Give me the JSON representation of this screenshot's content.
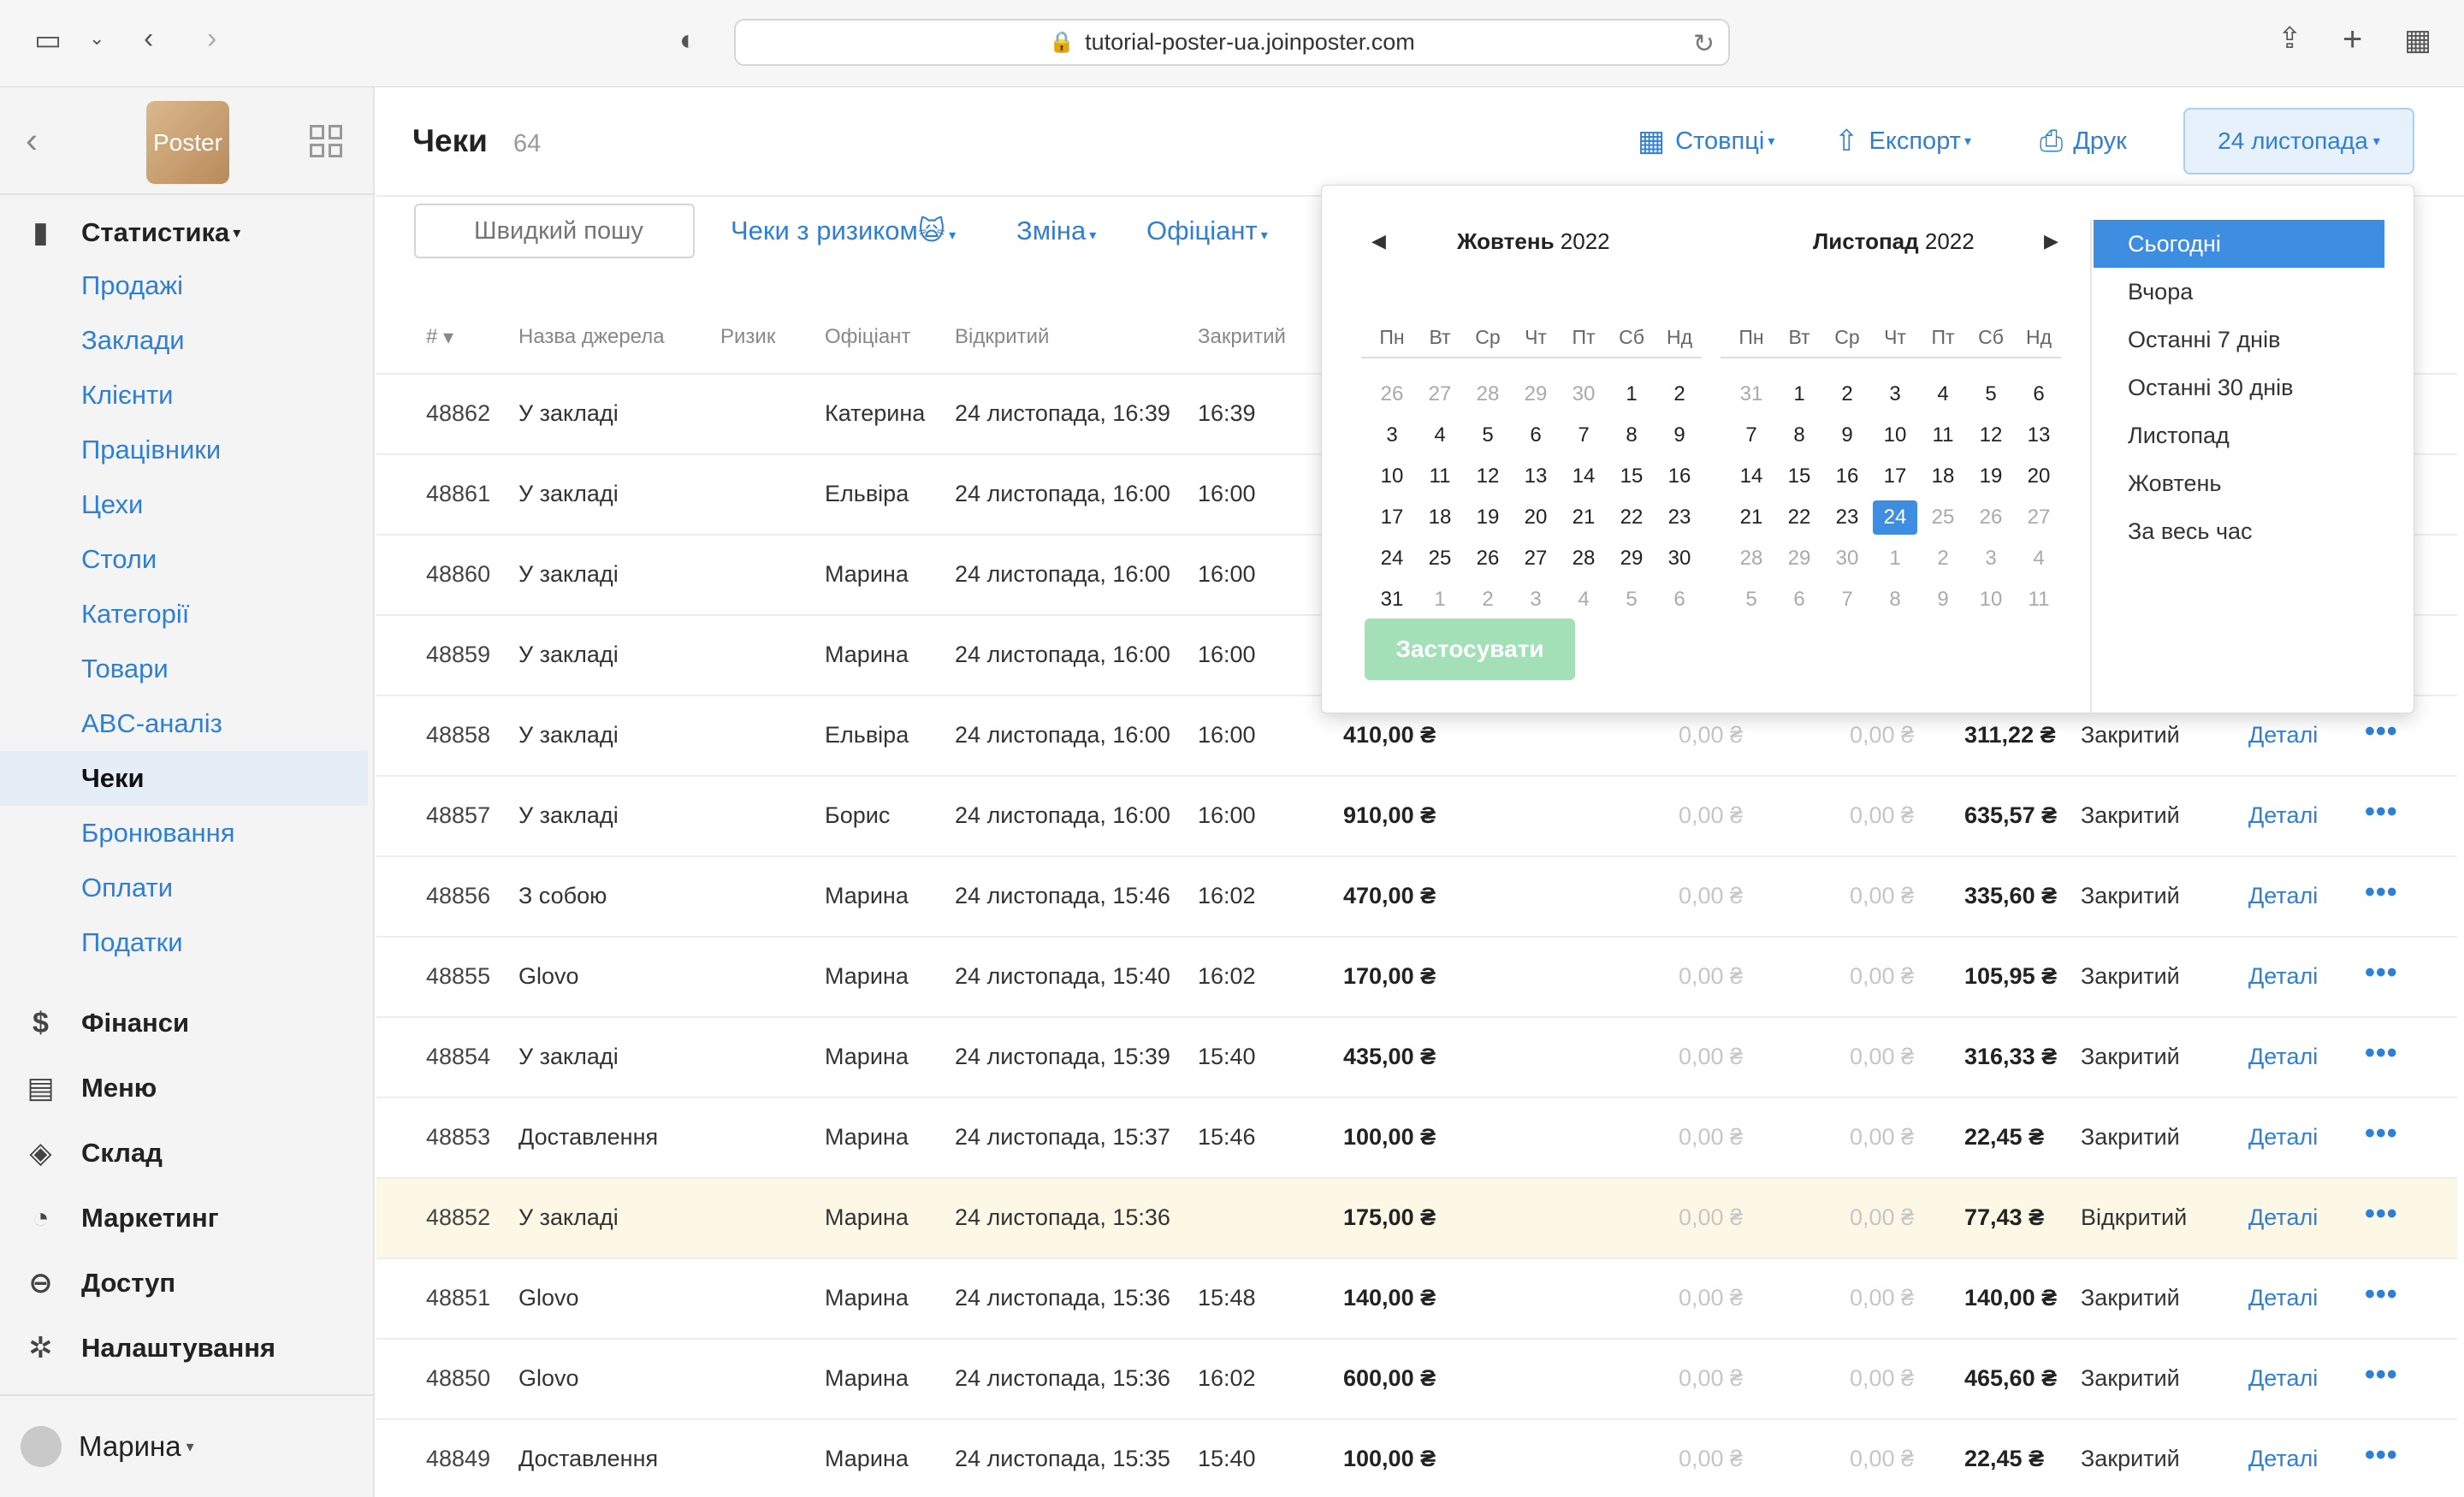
{
  "browser": {
    "url": "tutorial-poster-ua.joinposter.com"
  },
  "sidebar": {
    "logo_text": "Poster",
    "sections": [
      {
        "label": "Статистика",
        "icon": "bar-chart-icon",
        "dropdown": true
      },
      {
        "label": "Фінанси",
        "icon": "dollar-icon"
      },
      {
        "label": "Меню",
        "icon": "document-icon"
      },
      {
        "label": "Склад",
        "icon": "layers-icon"
      },
      {
        "label": "Маркетинг",
        "icon": "pie-icon"
      },
      {
        "label": "Доступ",
        "icon": "lock-icon"
      },
      {
        "label": "Налаштування",
        "icon": "gear-icon"
      }
    ],
    "stat_items": [
      "Продажі",
      "Заклади",
      "Клієнти",
      "Працівники",
      "Цехи",
      "Столи",
      "Категорії",
      "Товари",
      "ABC-аналіз",
      "Чеки",
      "Бронювання",
      "Оплати",
      "Податки"
    ],
    "active_item": "Чеки",
    "user": "Марина"
  },
  "header": {
    "title": "Чеки",
    "count": "64",
    "columns_btn": "Стовпці",
    "export_btn": "Експорт",
    "print_btn": "Друк",
    "date_btn": "24 листопада"
  },
  "filters": {
    "search_placeholder": "Швидкий пошу",
    "risk": "Чеки з ризиком",
    "shift": "Зміна",
    "waiter": "Офіціант"
  },
  "table": {
    "headers": [
      "#",
      "Назва джерела",
      "Ризик",
      "Офіціант",
      "Відкритий",
      "Закритий"
    ],
    "rows": [
      {
        "id": "48862",
        "source": "У закладі",
        "waiter": "Катерина",
        "opened": "24 листопада, 16:39",
        "closed": "16:39"
      },
      {
        "id": "48861",
        "source": "У закладі",
        "waiter": "Ельвіра",
        "opened": "24 листопада, 16:00",
        "closed": "16:00"
      },
      {
        "id": "48860",
        "source": "У закладі",
        "waiter": "Марина",
        "opened": "24 листопада, 16:00",
        "closed": "16:00"
      },
      {
        "id": "48859",
        "source": "У закладі",
        "waiter": "Марина",
        "opened": "24 листопада, 16:00",
        "closed": "16:00"
      },
      {
        "id": "48858",
        "source": "У закладі",
        "waiter": "Ельвіра",
        "opened": "24 листопада, 16:00",
        "closed": "16:00",
        "sum": "410,00 ₴",
        "a": "0,00 ₴",
        "b": "0,00 ₴",
        "profit": "311,22 ₴",
        "status": "Закритий",
        "details": "Деталі"
      },
      {
        "id": "48857",
        "source": "У закладі",
        "waiter": "Борис",
        "opened": "24 листопада, 16:00",
        "closed": "16:00",
        "sum": "910,00 ₴",
        "a": "0,00 ₴",
        "b": "0,00 ₴",
        "profit": "635,57 ₴",
        "status": "Закритий",
        "details": "Деталі"
      },
      {
        "id": "48856",
        "source": "З собою",
        "waiter": "Марина",
        "opened": "24 листопада, 15:46",
        "closed": "16:02",
        "sum": "470,00 ₴",
        "a": "0,00 ₴",
        "b": "0,00 ₴",
        "profit": "335,60 ₴",
        "status": "Закритий",
        "details": "Деталі"
      },
      {
        "id": "48855",
        "source": "Glovo",
        "waiter": "Марина",
        "opened": "24 листопада, 15:40",
        "closed": "16:02",
        "sum": "170,00 ₴",
        "a": "0,00 ₴",
        "b": "0,00 ₴",
        "profit": "105,95 ₴",
        "status": "Закритий",
        "details": "Деталі"
      },
      {
        "id": "48854",
        "source": "У закладі",
        "waiter": "Марина",
        "opened": "24 листопада, 15:39",
        "closed": "15:40",
        "sum": "435,00 ₴",
        "a": "0,00 ₴",
        "b": "0,00 ₴",
        "profit": "316,33 ₴",
        "status": "Закритий",
        "details": "Деталі"
      },
      {
        "id": "48853",
        "source": "Доставлення",
        "waiter": "Марина",
        "opened": "24 листопада, 15:37",
        "closed": "15:46",
        "sum": "100,00 ₴",
        "a": "0,00 ₴",
        "b": "0,00 ₴",
        "profit": "22,45 ₴",
        "status": "Закритий",
        "details": "Деталі"
      },
      {
        "id": "48852",
        "source": "У закладі",
        "waiter": "Марина",
        "opened": "24 листопада, 15:36",
        "closed": "",
        "sum": "175,00 ₴",
        "a": "0,00 ₴",
        "b": "0,00 ₴",
        "profit": "77,43 ₴",
        "status": "Відкритий",
        "details": "Деталі",
        "open": true
      },
      {
        "id": "48851",
        "source": "Glovo",
        "waiter": "Марина",
        "opened": "24 листопада, 15:36",
        "closed": "15:48",
        "sum": "140,00 ₴",
        "a": "0,00 ₴",
        "b": "0,00 ₴",
        "profit": "140,00 ₴",
        "status": "Закритий",
        "details": "Деталі"
      },
      {
        "id": "48850",
        "source": "Glovo",
        "waiter": "Марина",
        "opened": "24 листопада, 15:36",
        "closed": "16:02",
        "sum": "600,00 ₴",
        "a": "0,00 ₴",
        "b": "0,00 ₴",
        "profit": "465,60 ₴",
        "status": "Закритий",
        "details": "Деталі"
      },
      {
        "id": "48849",
        "source": "Доставлення",
        "waiter": "Марина",
        "opened": "24 листопада, 15:35",
        "closed": "15:40",
        "sum": "100,00 ₴",
        "a": "0,00 ₴",
        "b": "0,00 ₴",
        "profit": "22,45 ₴",
        "status": "Закритий",
        "details": "Деталі"
      }
    ]
  },
  "calendar": {
    "dow": [
      "Пн",
      "Вт",
      "Ср",
      "Чт",
      "Пт",
      "Сб",
      "Нд"
    ],
    "left": {
      "month": "Жовтень",
      "year": "2022",
      "weeks": [
        [
          "26",
          "27",
          "28",
          "29",
          "30",
          "1",
          "2"
        ],
        [
          "3",
          "4",
          "5",
          "6",
          "7",
          "8",
          "9"
        ],
        [
          "10",
          "11",
          "12",
          "13",
          "14",
          "15",
          "16"
        ],
        [
          "17",
          "18",
          "19",
          "20",
          "21",
          "22",
          "23"
        ],
        [
          "24",
          "25",
          "26",
          "27",
          "28",
          "29",
          "30"
        ],
        [
          "31",
          "1",
          "2",
          "3",
          "4",
          "5",
          "6"
        ]
      ],
      "muted": [
        [
          0,
          0
        ],
        [
          0,
          1
        ],
        [
          0,
          2
        ],
        [
          0,
          3
        ],
        [
          0,
          4
        ],
        [
          5,
          1
        ],
        [
          5,
          2
        ],
        [
          5,
          3
        ],
        [
          5,
          4
        ],
        [
          5,
          5
        ],
        [
          5,
          6
        ]
      ]
    },
    "right": {
      "month": "Листопад",
      "year": "2022",
      "weeks": [
        [
          "31",
          "1",
          "2",
          "3",
          "4",
          "5",
          "6"
        ],
        [
          "7",
          "8",
          "9",
          "10",
          "11",
          "12",
          "13"
        ],
        [
          "14",
          "15",
          "16",
          "17",
          "18",
          "19",
          "20"
        ],
        [
          "21",
          "22",
          "23",
          "24",
          "25",
          "26",
          "27"
        ],
        [
          "28",
          "29",
          "30",
          "1",
          "2",
          "3",
          "4"
        ],
        [
          "5",
          "6",
          "7",
          "8",
          "9",
          "10",
          "11"
        ]
      ],
      "muted": [
        [
          0,
          0
        ],
        [
          3,
          4
        ],
        [
          3,
          5
        ],
        [
          3,
          6
        ],
        [
          4,
          0
        ],
        [
          4,
          1
        ],
        [
          4,
          2
        ],
        [
          4,
          3
        ],
        [
          4,
          4
        ],
        [
          4,
          5
        ],
        [
          4,
          6
        ],
        [
          5,
          0
        ],
        [
          5,
          1
        ],
        [
          5,
          2
        ],
        [
          5,
          3
        ],
        [
          5,
          4
        ],
        [
          5,
          5
        ],
        [
          5,
          6
        ]
      ],
      "selected": [
        3,
        3
      ]
    },
    "apply": "Застосувати",
    "presets": [
      "Сьогодні",
      "Вчора",
      "Останні 7 днів",
      "Останні 30 днів",
      "Листопад",
      "Жовтень",
      "За весь час"
    ],
    "active_preset": "Сьогодні"
  }
}
